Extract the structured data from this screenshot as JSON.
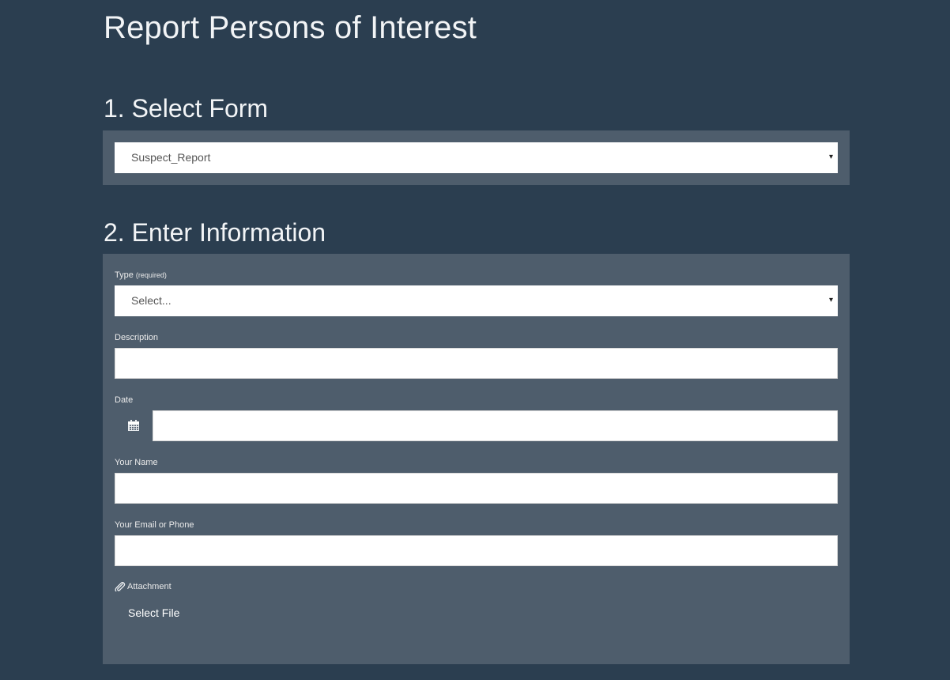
{
  "page": {
    "title": "Report Persons of Interest"
  },
  "section1": {
    "title": "1. Select Form",
    "form_select": {
      "value": "Suspect_Report",
      "caret": "▾"
    }
  },
  "section2": {
    "title": "2. Enter Information",
    "type": {
      "label": "Type",
      "required_note": "(required)",
      "value": "Select...",
      "caret": "▾"
    },
    "description": {
      "label": "Description",
      "value": ""
    },
    "date": {
      "label": "Date",
      "value": "",
      "icon": "calendar-icon"
    },
    "your_name": {
      "label": "Your Name",
      "value": ""
    },
    "email_phone": {
      "label": "Your Email or Phone",
      "value": ""
    },
    "attachment": {
      "label": "Attachment",
      "icon": "paperclip-icon",
      "button": "Select File"
    }
  },
  "colors": {
    "background": "#2b3e50",
    "panel": "#4e5d6c",
    "input": "#ffffff"
  }
}
